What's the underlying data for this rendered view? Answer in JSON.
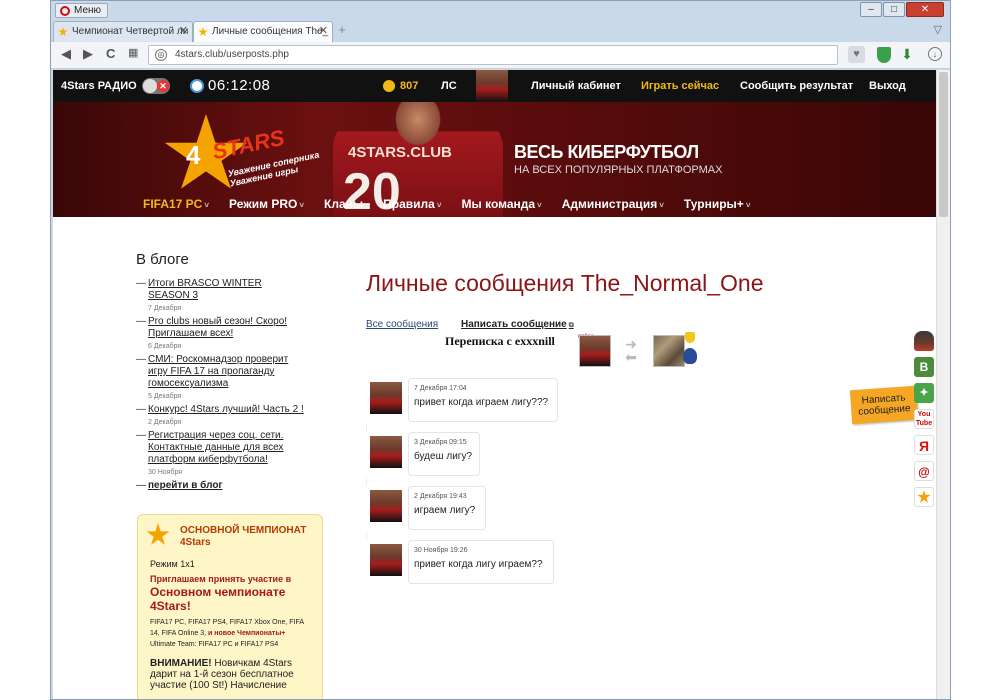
{
  "browser": {
    "menu_label": "Меню",
    "tabs": [
      {
        "label": "Чемпионат Четвертой ли"
      },
      {
        "label": "Личные сообщения The_"
      }
    ],
    "url": "4stars.club/userposts.php"
  },
  "sitebar": {
    "radio_label": "4Stars РАДИО",
    "time": "06:12:08",
    "coins": "807",
    "ls_label": "ЛС",
    "links": {
      "cabinet": "Личный кабинет",
      "play": "Играть сейчас",
      "report": "Сообщить результат",
      "logout": "Выход"
    }
  },
  "banner": {
    "logo_num": "4",
    "logo_text": "STARS",
    "slogan_1": "Уважение соперника",
    "slogan_2": "Уважение игры",
    "jersey_text": "4STARS.CLUB",
    "jersey_num": "20",
    "headline": "ВЕСЬ КИБЕРФУТБОЛ",
    "subline": "НА ВСЕХ ПОПУЛЯРНЫХ ПЛАТФОРМАХ"
  },
  "mainnav": [
    {
      "label": "FIFA17 PC",
      "active": true,
      "chev": true
    },
    {
      "label": "Режим PRO",
      "active": false,
      "chev": true
    },
    {
      "label": "Кланы",
      "active": false,
      "chev": false
    },
    {
      "label": "Правила",
      "active": false,
      "chev": true
    },
    {
      "label": "Мы команда",
      "active": false,
      "chev": true
    },
    {
      "label": "Администрация",
      "active": false,
      "chev": true
    },
    {
      "label": "Турниры+",
      "active": false,
      "chev": true
    }
  ],
  "blog": {
    "heading": "В блоге",
    "items": [
      {
        "title": "Итоги BRASCO WINTER SEASON 3",
        "date": "7 Декабря"
      },
      {
        "title": "Pro clubs новый сезон! Скоро! Приглашаем всех!",
        "date": "6 Декабря"
      },
      {
        "title": "СМИ: Роскомнадзор проверит игру FIFA 17 на пропаганду гомосексуализма",
        "date": "5 Декабря"
      },
      {
        "title": "Конкурс! 4Stars лучший! Часть 2 !",
        "date": "2 Декабря"
      },
      {
        "title": "Регистрация через соц. сети. Контактные данные для всех платформ киберфутбола!",
        "date": "30 Ноября"
      }
    ],
    "more": "перейти в блог"
  },
  "champ": {
    "title": "ОСНОВНОЙ ЧЕМПИОНАТ 4Stars",
    "mode": "Режим 1х1",
    "invite": "Приглашаем принять участие в",
    "invite_big": "Основном чемпионате 4Stars!",
    "platforms": "FIFA17 PC, FIFA17 PS4, FIFA17 Xbox One, FIFA 14, FIFA Online 3,",
    "new_label": "и новое Чемпионаты+",
    "platforms_2": "Ultimate Team: FIFA17 PC и FIFA17 PS4",
    "attention": "ВНИМАНИЕ!",
    "attention_text": "Новичкам 4Stars дарит на 1-й сезон бесплатное участие (100 St!) Начисление"
  },
  "messages_page": {
    "title": "Личные сообщения The_Normal_One",
    "tab_all": "Все сообщения",
    "tab_write": "Написать сообщение",
    "correspondence": "Переписка с exxxnill",
    "online": "online",
    "messages": [
      {
        "time": "7 Декабря 17:04",
        "text": "привет когда играем лигу???"
      },
      {
        "time": "3 Декабря 09:15",
        "text": "будеш лигу?"
      },
      {
        "time": "2 Декабря 19:43",
        "text": "играем лигу?"
      },
      {
        "time": "30 Ноября 19:26",
        "text": "привет когда лигу играем??"
      }
    ]
  },
  "social": {
    "write_label": "Написать сообщение",
    "icons": [
      "hat-icon",
      "vk-icon",
      "twitter-icon",
      "youtube-icon",
      "yandex-icon",
      "mail-icon",
      "4stars-icon"
    ],
    "vk_letter": "В",
    "yt_text": "You Tube",
    "ya_letter": "Я",
    "mail_letter": "@"
  }
}
